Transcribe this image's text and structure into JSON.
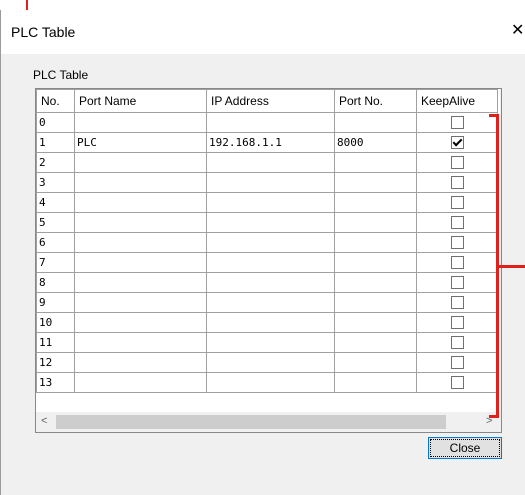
{
  "window": {
    "title": "PLC Table"
  },
  "group_label": "PLC Table",
  "table": {
    "columns": [
      "No.",
      "Port Name",
      "IP Address",
      "Port No.",
      "KeepAlive"
    ],
    "rows": [
      {
        "no": "0",
        "port_name": "",
        "ip": "",
        "port": "",
        "keepalive": false
      },
      {
        "no": "1",
        "port_name": "PLC",
        "ip": "192.168.1.1",
        "port": "8000",
        "keepalive": true
      },
      {
        "no": "2",
        "port_name": "",
        "ip": "",
        "port": "",
        "keepalive": false
      },
      {
        "no": "3",
        "port_name": "",
        "ip": "",
        "port": "",
        "keepalive": false
      },
      {
        "no": "4",
        "port_name": "",
        "ip": "",
        "port": "",
        "keepalive": false
      },
      {
        "no": "5",
        "port_name": "",
        "ip": "",
        "port": "",
        "keepalive": false
      },
      {
        "no": "6",
        "port_name": "",
        "ip": "",
        "port": "",
        "keepalive": false
      },
      {
        "no": "7",
        "port_name": "",
        "ip": "",
        "port": "",
        "keepalive": false
      },
      {
        "no": "8",
        "port_name": "",
        "ip": "",
        "port": "",
        "keepalive": false
      },
      {
        "no": "9",
        "port_name": "",
        "ip": "",
        "port": "",
        "keepalive": false
      },
      {
        "no": "10",
        "port_name": "",
        "ip": "",
        "port": "",
        "keepalive": false
      },
      {
        "no": "11",
        "port_name": "",
        "ip": "",
        "port": "",
        "keepalive": false
      },
      {
        "no": "12",
        "port_name": "",
        "ip": "",
        "port": "",
        "keepalive": false
      },
      {
        "no": "13",
        "port_name": "",
        "ip": "",
        "port": "",
        "keepalive": false
      }
    ]
  },
  "buttons": {
    "close": "Close"
  },
  "icons": {
    "window_close": "close-icon",
    "scroll_up": "chevron-up-icon",
    "scroll_down": "chevron-down-icon",
    "scroll_left": "chevron-left-icon",
    "scroll_right": "chevron-right-icon"
  },
  "colors": {
    "annotation": "#e0201a",
    "focus": "#0078d7"
  }
}
